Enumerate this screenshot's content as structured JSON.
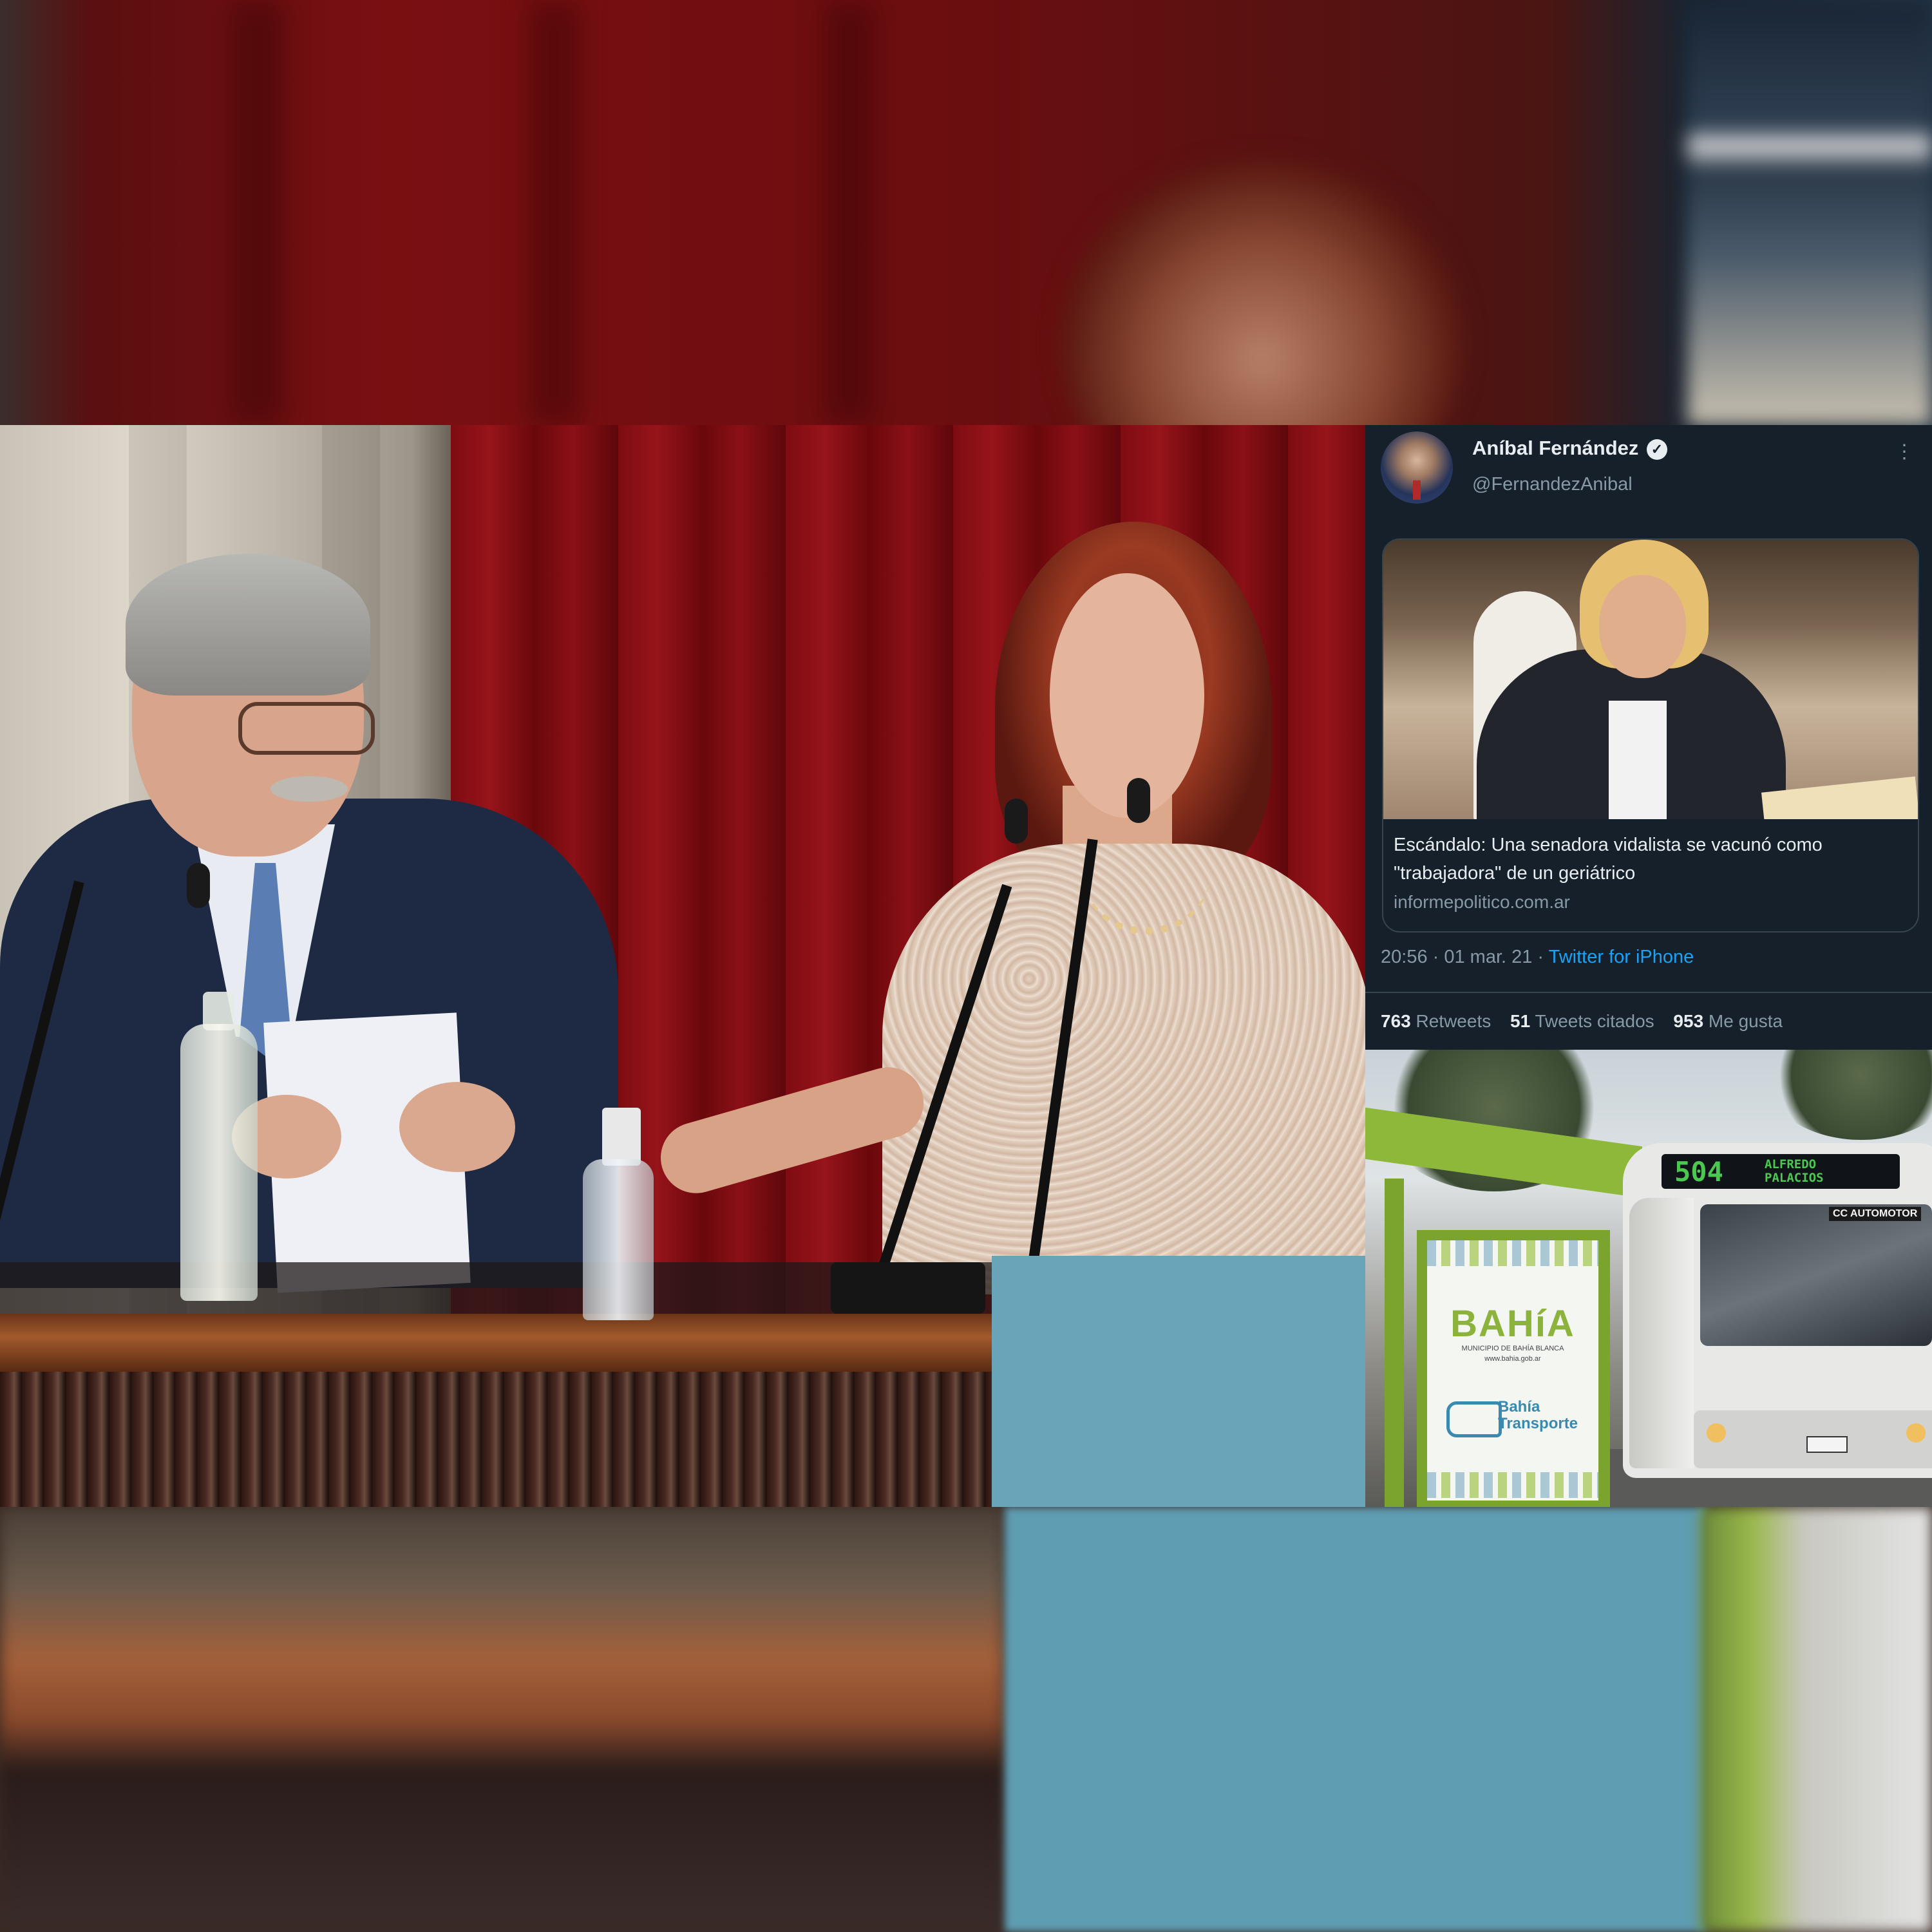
{
  "tweet": {
    "display_name": "Aníbal Fernández",
    "verified_icon": "verified-badge-icon",
    "handle": "@FernandezAnibal",
    "more_icon": "more-options-icon",
    "card": {
      "title": "Escándalo: Una senadora vidalista se vacunó como \"trabajadora\" de un geriátrico",
      "domain": "informepolitico.com.ar"
    },
    "timestamp": "20:56 · 01 mar. 21 · ",
    "source_link": "Twitter for iPhone",
    "stats": {
      "retweets_count": "763",
      "retweets_label": "Retweets",
      "quotes_count": "51",
      "quotes_label": "Tweets citados",
      "likes_count": "953",
      "likes_label": "Me gusta"
    },
    "colors": {
      "background": "#15202b",
      "text": "#e8edf1",
      "muted": "#8899a6",
      "link": "#1da1f2"
    }
  },
  "bus_photo": {
    "poster_logo": "BAHíA",
    "poster_subtitle": "MUNICIPIO DE BAHÍA BLANCA",
    "poster_website": "www.bahia.gob.ar",
    "poster_transport": "Bahía\nTransporte",
    "bus_route_number": "504",
    "bus_destination": "ALFREDO\nPALACIOS",
    "bus_operator": "CC AUTOMOTOR"
  }
}
